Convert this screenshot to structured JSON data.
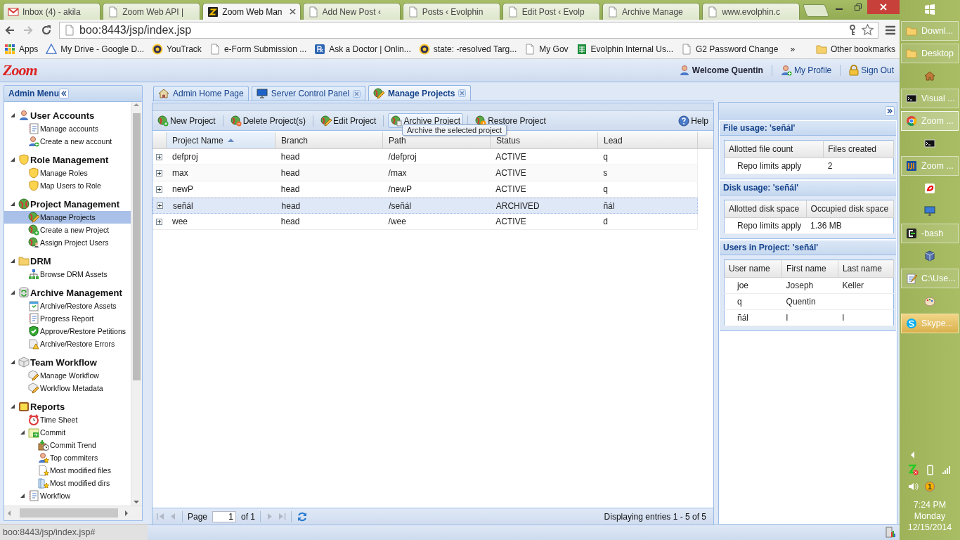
{
  "browser": {
    "tabs": [
      {
        "title": "Inbox (4) - akila",
        "selected": false
      },
      {
        "title": "Zoom Web API |",
        "selected": false
      },
      {
        "title": "Zoom Web Man",
        "selected": true
      },
      {
        "title": "Add New Post ‹",
        "selected": false
      },
      {
        "title": "Posts ‹ Evolphin",
        "selected": false
      },
      {
        "title": "Edit Post ‹ Evolp",
        "selected": false
      },
      {
        "title": "Archive Manage",
        "selected": false
      },
      {
        "title": "www.evolphin.c",
        "selected": false
      }
    ],
    "address": "boo:8443/jsp/index.jsp",
    "bookmarks": [
      "Apps",
      "My Drive - Google D...",
      "YouTrack",
      "e-Form Submission ...",
      "Ask a Doctor | Onlin...",
      "state: -resolved Targ...",
      "My Gov",
      "Evolphin Internal Us...",
      "G2 Password Change"
    ],
    "more_bookmarks": "»",
    "other_bookmarks": "Other bookmarks",
    "status_url": "boo:8443/jsp/index.jsp#"
  },
  "app": {
    "logo": "Zoom",
    "header_links": [
      "Welcome Quentin",
      "My Profile",
      "Sign Out"
    ]
  },
  "admin_menu": {
    "title": "Admin Menu",
    "sections": [
      {
        "label": "User Accounts",
        "expanded": true,
        "selected": false,
        "children": [
          {
            "label": "Manage accounts",
            "selected": false
          },
          {
            "label": "Create a new account",
            "selected": false
          }
        ]
      },
      {
        "label": "Role Management",
        "expanded": true,
        "selected": false,
        "children": [
          {
            "label": "Manage Roles",
            "selected": false
          },
          {
            "label": "Map Users to Role",
            "selected": false
          }
        ]
      },
      {
        "label": "Project Management",
        "expanded": true,
        "selected": false,
        "children": [
          {
            "label": "Manage Projects",
            "selected": true
          },
          {
            "label": "Create a new Project",
            "selected": false
          },
          {
            "label": "Assign Project Users",
            "selected": false
          }
        ]
      },
      {
        "label": "DRM",
        "expanded": true,
        "selected": false,
        "children": [
          {
            "label": "Browse DRM Assets",
            "selected": false
          }
        ]
      },
      {
        "label": "Archive Management",
        "expanded": true,
        "selected": false,
        "children": [
          {
            "label": "Archive/Restore Assets",
            "selected": false
          },
          {
            "label": "Progress Report",
            "selected": false
          },
          {
            "label": "Approve/Restore Petitions",
            "selected": false
          },
          {
            "label": "Archive/Restore Errors",
            "selected": false
          }
        ]
      },
      {
        "label": "Team Workflow",
        "expanded": true,
        "selected": false,
        "children": [
          {
            "label": "Manage Workflow",
            "selected": false
          },
          {
            "label": "Workflow Metadata",
            "selected": false
          }
        ]
      },
      {
        "label": "Reports",
        "expanded": true,
        "selected": false,
        "children": [
          {
            "label": "Time Sheet",
            "selected": false
          },
          {
            "label": "Commit",
            "expanded": true,
            "selected": false,
            "children": [
              {
                "label": "Commit Trend",
                "selected": false
              },
              {
                "label": "Top commiters",
                "selected": false
              },
              {
                "label": "Most modified files",
                "selected": false
              },
              {
                "label": "Most modified dirs",
                "selected": false
              }
            ]
          },
          {
            "label": "Workflow",
            "expanded": true,
            "selected": false
          }
        ]
      }
    ]
  },
  "content_tabs": [
    {
      "label": "Admin Home Page",
      "selected": false,
      "closable": false
    },
    {
      "label": "Server Control Panel",
      "selected": false,
      "closable": true
    },
    {
      "label": "Manage Projects",
      "selected": true,
      "closable": true
    }
  ],
  "toolbar": {
    "buttons": [
      {
        "label": "New Project",
        "hovered": false
      },
      {
        "label": "Delete Project(s)",
        "hovered": false
      },
      {
        "label": "Edit Project",
        "hovered": false
      },
      {
        "label": "Archive Project",
        "hovered": true
      },
      {
        "label": "Restore Project",
        "hovered": false
      }
    ],
    "help": "Help",
    "tooltip": "Archive the selected project"
  },
  "grid": {
    "columns": [
      {
        "label": "Project Name",
        "sorted": true
      },
      {
        "label": "Branch",
        "sorted": false
      },
      {
        "label": "Path",
        "sorted": false
      },
      {
        "label": "Status",
        "sorted": false
      },
      {
        "label": "Lead",
        "sorted": false
      }
    ],
    "rows": [
      {
        "cells": [
          "defproj",
          "head",
          "/defproj",
          "ACTIVE",
          "q"
        ],
        "selected": false,
        "expanded": false
      },
      {
        "cells": [
          "max",
          "head",
          "/max",
          "ACTIVE",
          "s"
        ],
        "selected": false,
        "expanded": false
      },
      {
        "cells": [
          "newP",
          "head",
          "/newP",
          "ACTIVE",
          "q"
        ],
        "selected": false,
        "expanded": false
      },
      {
        "cells": [
          "señál",
          "head",
          "/señál",
          "ARCHIVED",
          "ñál"
        ],
        "selected": true,
        "expanded": false
      },
      {
        "cells": [
          "wee",
          "head",
          "/wee",
          "ACTIVE",
          "d"
        ],
        "selected": false,
        "expanded": false
      }
    ]
  },
  "pager": {
    "page_label": "Page",
    "page": "1",
    "of": "of 1",
    "display": "Displaying entries 1 - 5 of 5"
  },
  "info_panels": [
    {
      "title": "File usage: 'señál'",
      "columns": [
        "Allotted file count",
        "Files created"
      ],
      "rows": [
        [
          "Repo limits apply",
          "2"
        ]
      ]
    },
    {
      "title": "Disk usage: 'señál'",
      "columns": [
        "Allotted disk space",
        "Occupied disk space"
      ],
      "rows": [
        [
          "Repo limits apply",
          "1.36 MB"
        ]
      ]
    },
    {
      "title": "Users in Project: 'señál'",
      "columns": [
        "User name",
        "First name",
        "Last name"
      ],
      "rows": [
        [
          "joe",
          "Joseph",
          "Keller"
        ],
        [
          "q",
          "Quentin",
          ""
        ],
        [
          "ñál",
          "l",
          "l"
        ]
      ]
    }
  ],
  "taskbar": {
    "items": [
      {
        "kind": "start"
      },
      {
        "kind": "button",
        "label": "Downl...",
        "active": false,
        "flashing": false
      },
      {
        "kind": "button",
        "label": "Desktop",
        "active": false,
        "flashing": false
      },
      {
        "kind": "icon"
      },
      {
        "kind": "button",
        "label": "Visual ...",
        "active": false,
        "flashing": false
      },
      {
        "kind": "button",
        "label": "Zoom ...",
        "active": true,
        "flashing": false
      },
      {
        "kind": "icon"
      },
      {
        "kind": "button",
        "label": "Zoom ...",
        "active": false,
        "flashing": false
      },
      {
        "kind": "icon"
      },
      {
        "kind": "icon"
      },
      {
        "kind": "button",
        "label": "-bash",
        "active": false,
        "flashing": false
      },
      {
        "kind": "icon"
      },
      {
        "kind": "button",
        "label": "C:\\Use...",
        "active": false,
        "flashing": false
      },
      {
        "kind": "icon"
      },
      {
        "kind": "button",
        "label": "Skype...",
        "active": false,
        "flashing": true
      }
    ],
    "clock": {
      "time": "7:24 PM",
      "day": "Monday",
      "date": "12/15/2014"
    },
    "notification_count": "1"
  }
}
